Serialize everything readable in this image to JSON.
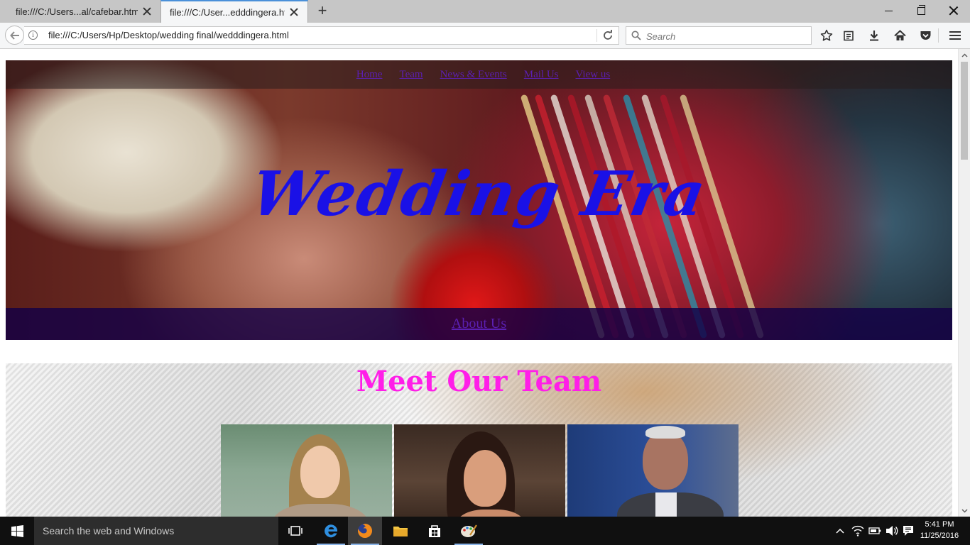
{
  "browser": {
    "tabs": [
      {
        "label": "file:///C:/Users...al/cafebar.html",
        "active": false
      },
      {
        "label": "file:///C:/User...edddingera.html",
        "active": true
      }
    ],
    "url": "file:///C:/Users/Hp/Desktop/wedding final/wedddingera.html",
    "search_placeholder": "Search"
  },
  "page": {
    "nav": [
      "Home",
      "Team",
      "News & Events",
      "Mail Us",
      "View us"
    ],
    "hero_title": "Wedding Era",
    "about_link": "About Us",
    "team_title": "Meet Our Team"
  },
  "taskbar": {
    "search_placeholder": "Search the web and Windows",
    "time": "5:41 PM",
    "date": "11/25/2016"
  },
  "colors": {
    "hero_title": "#1a11e6",
    "team_title": "#ff1ee8",
    "nav_link": "#5b1fb1"
  }
}
